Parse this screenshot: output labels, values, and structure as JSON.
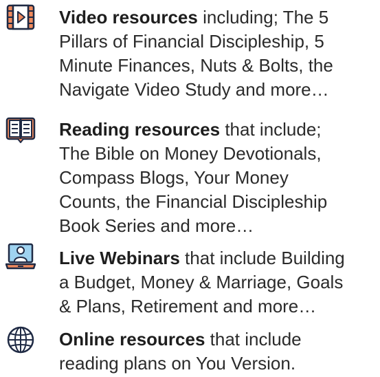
{
  "resources": [
    {
      "icon": "video-film-icon",
      "title": "Video resources",
      "lines": [
        "including; The 5",
        "Pillars of Financial Discipleship, 5",
        "Minute Finances, Nuts & Bolts, the",
        "Navigate Video Study and more…"
      ]
    },
    {
      "icon": "open-book-icon",
      "title": "Reading resources",
      "lines": [
        "that include;",
        "The Bible on Money Devotionals,",
        "Compass Blogs, Your Money",
        "Counts, the Financial Discipleship",
        "Book Series  and more…"
      ]
    },
    {
      "icon": "webinar-laptop-icon",
      "title": "Live Webinars",
      "lines": [
        "that include Building",
        "a Budget, Money & Marriage, Goals",
        "& Plans, Retirement and more…"
      ]
    },
    {
      "icon": "globe-icon",
      "title": "Online resources",
      "lines": [
        "that include",
        "reading plans on You Version."
      ]
    }
  ],
  "colors": {
    "icon_fill": "#f08a5d",
    "icon_stroke": "#1f2a44",
    "text": "#2b2b2b"
  }
}
